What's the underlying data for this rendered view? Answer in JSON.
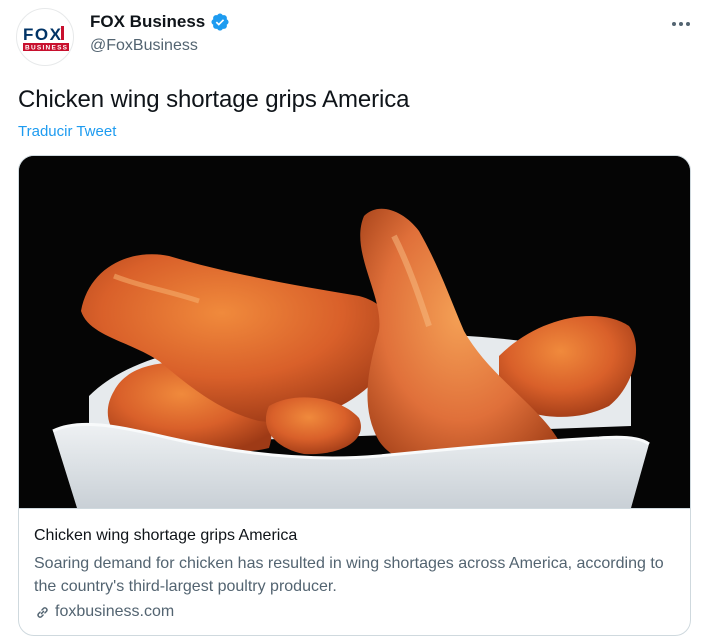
{
  "account": {
    "display_name": "FOX Business",
    "handle": "@FoxBusiness",
    "avatar_brand": "FOX",
    "avatar_sub": "BUSINESS",
    "verified": true
  },
  "tweet": {
    "text": "Chicken wing shortage grips America",
    "translate_label": "Traducir Tweet"
  },
  "card": {
    "title": "Chicken wing shortage grips America",
    "description": "Soaring demand for chicken has resulted in wing shortages across America, according to the country's third-largest poultry producer.",
    "domain": "foxbusiness.com",
    "image_subject": "fried chicken wings in white paper tray"
  },
  "colors": {
    "accent": "#1d9bf0",
    "text_primary": "#0f1419",
    "text_secondary": "#536471",
    "fox_blue": "#003366",
    "fox_red": "#c8102e"
  },
  "icons": {
    "verified": "verified-badge-icon",
    "more": "more-options-icon",
    "link": "link-icon"
  }
}
